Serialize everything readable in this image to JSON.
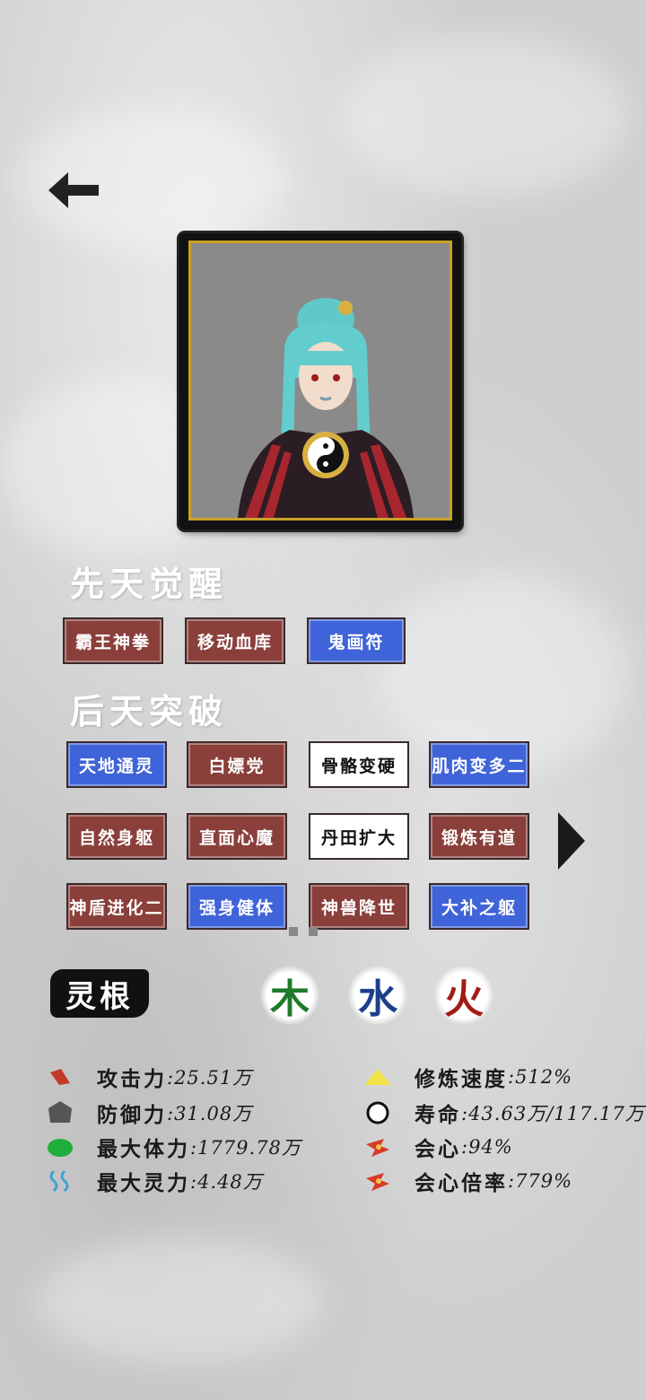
{
  "sections": {
    "innate_title": "先天觉醒",
    "acquired_title": "后天突破"
  },
  "innate_tags": [
    {
      "label": "霸王神拳",
      "color": "red"
    },
    {
      "label": "移动血库",
      "color": "red"
    },
    {
      "label": "鬼画符",
      "color": "blue"
    }
  ],
  "acquired_tags": [
    {
      "label": "天地通灵",
      "color": "blue"
    },
    {
      "label": "白嫖党",
      "color": "red"
    },
    {
      "label": "骨骼变硬",
      "color": "white"
    },
    {
      "label": "肌肉变多二",
      "color": "blue"
    },
    {
      "label": "自然身躯",
      "color": "red"
    },
    {
      "label": "直面心魔",
      "color": "red"
    },
    {
      "label": "丹田扩大",
      "color": "white"
    },
    {
      "label": "锻炼有道",
      "color": "red"
    },
    {
      "label": "神盾进化二",
      "color": "red"
    },
    {
      "label": "强身健体",
      "color": "blue"
    },
    {
      "label": "神兽降世",
      "color": "red"
    },
    {
      "label": "大补之躯",
      "color": "blue"
    }
  ],
  "spirit_root": {
    "label": "灵根",
    "elements": [
      {
        "char": "木",
        "color": "#1f7a2a"
      },
      {
        "char": "水",
        "color": "#1d3f8c"
      },
      {
        "char": "火",
        "color": "#a31c16"
      }
    ]
  },
  "stats_left": [
    {
      "label": "攻击力",
      "value": ":25.51万",
      "icon": "sword-icon"
    },
    {
      "label": "防御力",
      "value": ":31.08万",
      "icon": "shield-icon"
    },
    {
      "label": "最大体力",
      "value": ":1779.78万",
      "icon": "stamina-icon"
    },
    {
      "label": "最大灵力",
      "value": ":4.48万",
      "icon": "spirit-wave-icon"
    }
  ],
  "stats_right": [
    {
      "label": "修炼速度",
      "value": ":512%",
      "icon": "mountain-icon"
    },
    {
      "label": "寿命",
      "value": ":43.63万/117.17万",
      "icon": "lifespan-ring-icon"
    },
    {
      "label": "会心",
      "value": ":94%",
      "icon": "critical-icon"
    },
    {
      "label": "会心倍率",
      "value": ":779%",
      "icon": "critical-rate-icon"
    }
  ]
}
